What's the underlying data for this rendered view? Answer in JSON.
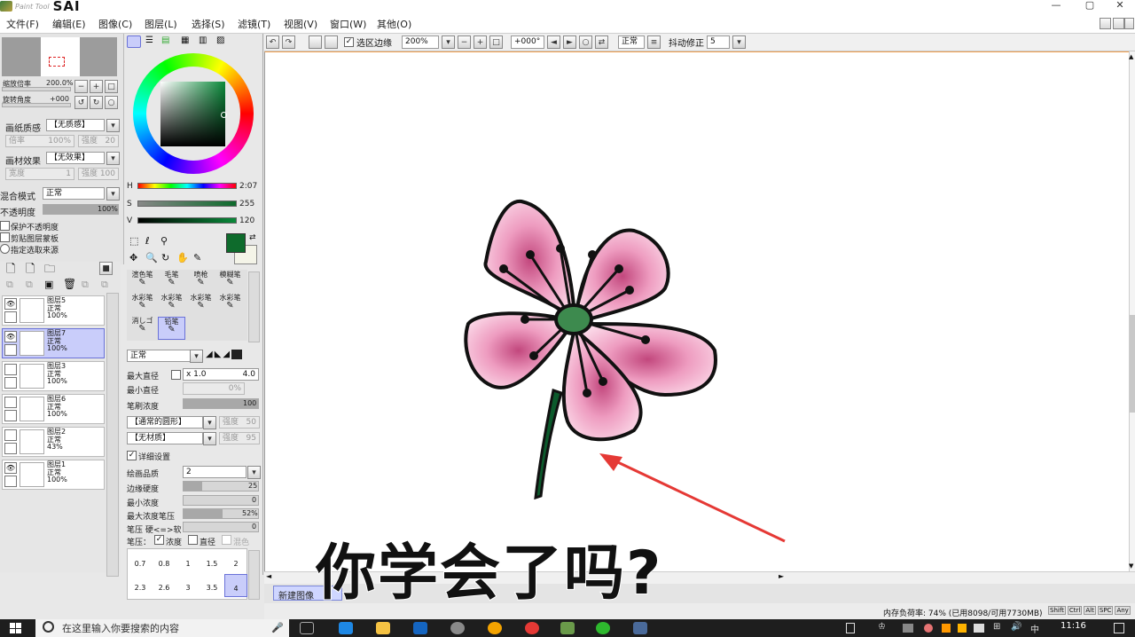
{
  "app": {
    "brand_small": "Paint Tool",
    "brand": "SAI"
  },
  "menu": [
    "文件(F)",
    "编辑(E)",
    "图像(C)",
    "图层(L)",
    "选择(S)",
    "滤镜(T)",
    "视图(V)",
    "窗口(W)",
    "其他(O)"
  ],
  "window_controls": {
    "minimize": "—",
    "maximize": "▢",
    "close": "✕"
  },
  "toolbar": {
    "selection_edge_label": "选区边缘",
    "zoom": "200%",
    "angle": "+000°",
    "blend": "正常",
    "stabilizer_label": "抖动修正",
    "stabilizer": "5"
  },
  "navigator": {
    "zoom_label": "缩放倍率",
    "zoom_value": "200.0%",
    "rotate_label": "旋转角度",
    "rotate_value": "+000"
  },
  "paper": {
    "texture_label": "画纸质感",
    "texture_value": "【无质感】",
    "scale_label": "倍率",
    "scale_value": "100%",
    "strength_label": "强度",
    "strength_value": "20",
    "effect_label": "画材效果",
    "effect_value": "【无效果】",
    "width_label": "宽度",
    "width_value": "1",
    "effect_strength_label": "强度",
    "effect_strength_value": "100"
  },
  "layer_props": {
    "blend_label": "混合模式",
    "blend_value": "正常",
    "opacity_label": "不透明度",
    "opacity_value": "100%",
    "protect": "保护不透明度",
    "clip": "剪贴图层蒙板",
    "source": "指定选取来源"
  },
  "layers": [
    {
      "name": "图层5",
      "mode": "正常",
      "opacity": "100%",
      "eye": "👁",
      "selected": false
    },
    {
      "name": "图层7",
      "mode": "正常",
      "opacity": "100%",
      "eye": "👁",
      "selected": true
    },
    {
      "name": "图层3",
      "mode": "正常",
      "opacity": "100%",
      "eye": "",
      "selected": false
    },
    {
      "name": "图层6",
      "mode": "正常",
      "opacity": "100%",
      "eye": "",
      "selected": false
    },
    {
      "name": "图层2",
      "mode": "正常",
      "opacity": "43%",
      "eye": "",
      "selected": false
    },
    {
      "name": "图层1",
      "mode": "正常",
      "opacity": "100%",
      "eye": "👁",
      "selected": false
    }
  ],
  "hsv": {
    "h_label": "H",
    "h": "2:07",
    "s_label": "S",
    "s": "255",
    "v_label": "V",
    "v": "120"
  },
  "colors": {
    "current": "#0e6b2c",
    "accent": "#f0a050",
    "selection": "#c9cdfa"
  },
  "tools": [
    {
      "top": "渲色笔",
      "bottom": ""
    },
    {
      "top": "毛笔",
      "bottom": ""
    },
    {
      "top": "喷枪",
      "bottom": ""
    },
    {
      "top": "模糊笔",
      "bottom": ""
    },
    {
      "top": "水彩笔",
      "bottom": ""
    },
    {
      "top": "水彩笔",
      "bottom": ""
    },
    {
      "top": "水彩笔",
      "bottom": ""
    },
    {
      "top": "水彩笔",
      "bottom": ""
    },
    {
      "top": "消しゴ",
      "bottom": ""
    },
    {
      "top": "铅笔",
      "bottom": ""
    }
  ],
  "brush": {
    "mode": "正常",
    "max_size_label": "最大直径",
    "max_size_mult": "x 1.0",
    "max_size": "4.0",
    "min_size_label": "最小直径",
    "min_size": "0%",
    "density_label": "笔刷浓度",
    "density": "100",
    "shape": "【通常的圆形】",
    "shape_strength_label": "强度",
    "shape_strength": "50",
    "texture": "【无材质】",
    "texture_strength_label": "强度",
    "texture_strength": "95",
    "detail": "详细设置",
    "quality_label": "绘画品质",
    "quality": "2",
    "edge_label": "边缘硬度",
    "edge": "25",
    "min_density_label": "最小浓度",
    "min_density": "0",
    "max_pressure_label": "最大浓度笔压",
    "max_pressure": "52%",
    "pressure_label": "笔压 硬<=>软",
    "pressure": "0",
    "pen_label": "笔压：",
    "pen_density": "浓度",
    "pen_size": "直径",
    "pen_blend": "混色",
    "size_presets": [
      "0.7",
      "0.8",
      "1",
      "1.5",
      "2",
      "2.3",
      "2.6",
      "3",
      "3.5",
      "4"
    ]
  },
  "document": {
    "tab": "新建图像",
    "status": "内存负荷率: 74% (已用8098/可用7730MB)"
  },
  "keys": [
    "Shift",
    "Ctrl",
    "Alt",
    "SPC",
    "Any"
  ],
  "subtitle": "你学会了吗?",
  "taskbar": {
    "search_placeholder": "在这里输入你要搜索的内容",
    "time": "11:16"
  }
}
